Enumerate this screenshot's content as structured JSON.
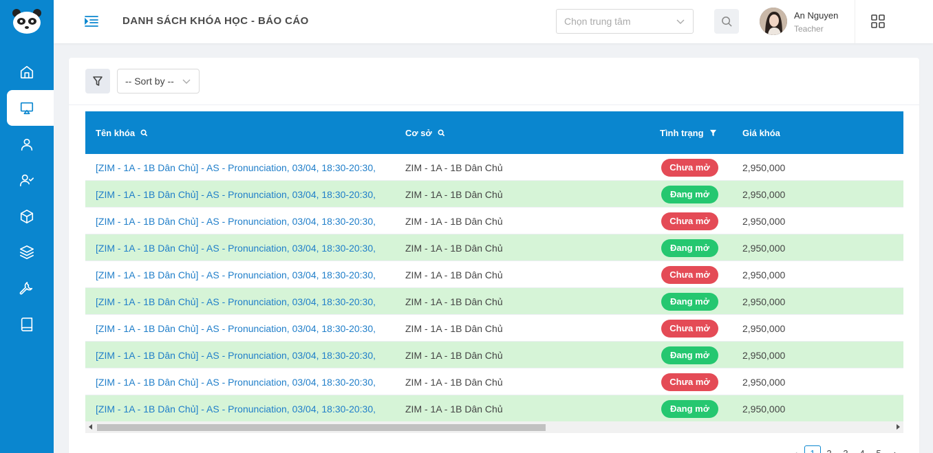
{
  "header": {
    "title": "DANH SÁCH KHÓA HỌC - BÁO CÁO",
    "center_placeholder": "Chọn trung tâm",
    "user_name": "An Nguyen",
    "user_role": "Teacher"
  },
  "sidebar": {
    "items": [
      {
        "icon": "home-icon"
      },
      {
        "icon": "presentation-icon",
        "active": true
      },
      {
        "icon": "user-icon"
      },
      {
        "icon": "user-check-icon"
      },
      {
        "icon": "box-icon"
      },
      {
        "icon": "layers-icon"
      },
      {
        "icon": "wrench-icon"
      },
      {
        "icon": "book-icon"
      }
    ]
  },
  "toolbar": {
    "sort_label": "-- Sort by --"
  },
  "table": {
    "columns": {
      "name": "Tên khóa",
      "site": "Cơ sở",
      "status": "Tình trạng",
      "price": "Giá khóa"
    },
    "rows": [
      {
        "name": "[ZIM - 1A - 1B Dân Chủ] - AS - Pronunciation, 03/04, 18:30-20:30,",
        "site": "ZIM - 1A - 1B Dân Chủ",
        "status": "Chưa mở",
        "price": "2,950,000"
      },
      {
        "name": "[ZIM - 1A - 1B Dân Chủ] - AS - Pronunciation, 03/04, 18:30-20:30,",
        "site": "ZIM - 1A - 1B Dân Chủ",
        "status": "Đang mở",
        "price": "2,950,000"
      },
      {
        "name": "[ZIM - 1A - 1B Dân Chủ] - AS - Pronunciation, 03/04, 18:30-20:30,",
        "site": "ZIM - 1A - 1B Dân Chủ",
        "status": "Chưa mở",
        "price": "2,950,000"
      },
      {
        "name": "[ZIM - 1A - 1B Dân Chủ] - AS - Pronunciation, 03/04, 18:30-20:30,",
        "site": "ZIM - 1A - 1B Dân Chủ",
        "status": "Đang mở",
        "price": "2,950,000"
      },
      {
        "name": "[ZIM - 1A - 1B Dân Chủ] - AS - Pronunciation, 03/04, 18:30-20:30,",
        "site": "ZIM - 1A - 1B Dân Chủ",
        "status": "Chưa mở",
        "price": "2,950,000"
      },
      {
        "name": "[ZIM - 1A - 1B Dân Chủ] - AS - Pronunciation, 03/04, 18:30-20:30,",
        "site": "ZIM - 1A - 1B Dân Chủ",
        "status": "Đang mở",
        "price": "2,950,000"
      },
      {
        "name": "[ZIM - 1A - 1B Dân Chủ] - AS - Pronunciation, 03/04, 18:30-20:30,",
        "site": "ZIM - 1A - 1B Dân Chủ",
        "status": "Chưa mở",
        "price": "2,950,000"
      },
      {
        "name": "[ZIM - 1A - 1B Dân Chủ] - AS - Pronunciation, 03/04, 18:30-20:30,",
        "site": "ZIM - 1A - 1B Dân Chủ",
        "status": "Đang mở",
        "price": "2,950,000"
      },
      {
        "name": "[ZIM - 1A - 1B Dân Chủ] - AS - Pronunciation, 03/04, 18:30-20:30,",
        "site": "ZIM - 1A - 1B Dân Chủ",
        "status": "Chưa mở",
        "price": "2,950,000"
      },
      {
        "name": "[ZIM - 1A - 1B Dân Chủ] - AS - Pronunciation, 03/04, 18:30-20:30,",
        "site": "ZIM - 1A - 1B Dân Chủ",
        "status": "Đang mở",
        "price": "2,950,000"
      }
    ]
  },
  "pagination": {
    "prev": "‹",
    "pages": [
      "1",
      "2",
      "3",
      "4",
      "5"
    ],
    "next": "›",
    "current": "1"
  },
  "colors": {
    "primary": "#0a86cf",
    "row_alt": "#d6f4d7",
    "status_closed": "#e44b56",
    "status_open": "#25c770",
    "link": "#1f7ec9"
  }
}
